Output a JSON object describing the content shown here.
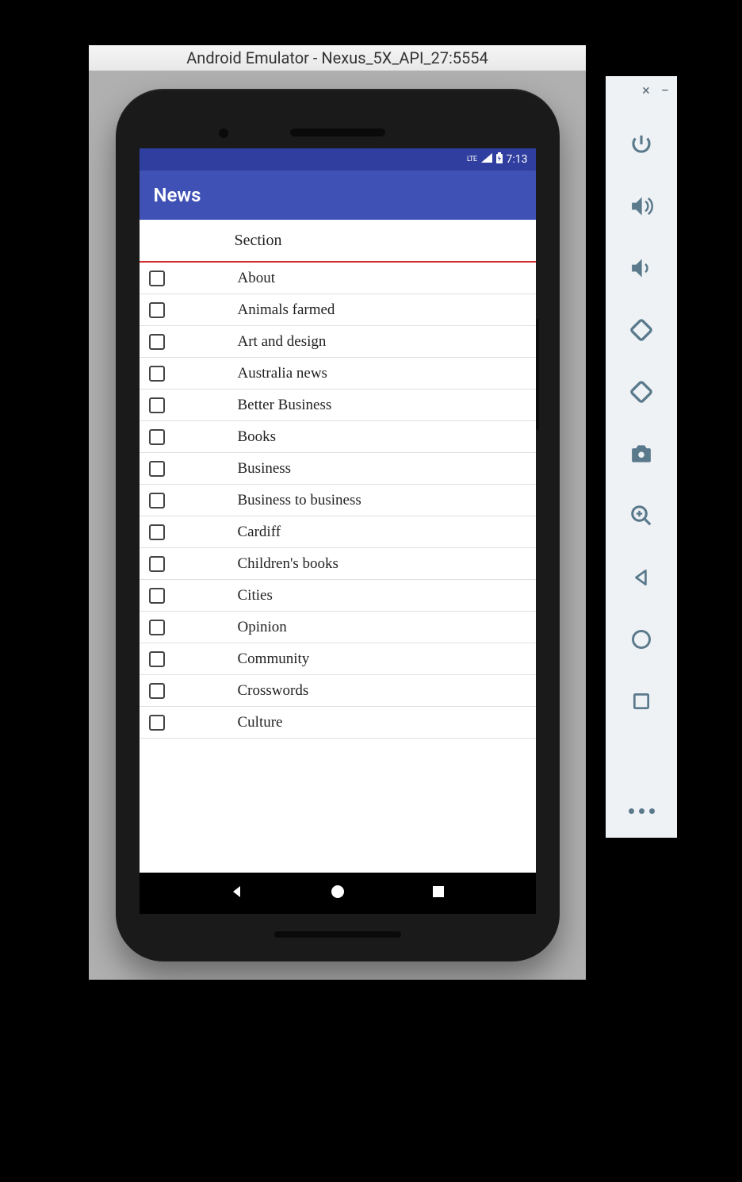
{
  "emulator": {
    "title": "Android Emulator - Nexus_5X_API_27:5554"
  },
  "status": {
    "network": "LTE",
    "time": "7:13"
  },
  "app": {
    "title": "News"
  },
  "section": {
    "header": "Section",
    "items": [
      {
        "label": "About",
        "checked": false
      },
      {
        "label": "Animals farmed",
        "checked": false
      },
      {
        "label": "Art and design",
        "checked": false
      },
      {
        "label": "Australia news",
        "checked": false
      },
      {
        "label": "Better Business",
        "checked": false
      },
      {
        "label": "Books",
        "checked": false
      },
      {
        "label": "Business",
        "checked": false
      },
      {
        "label": "Business to business",
        "checked": false
      },
      {
        "label": "Cardiff",
        "checked": false
      },
      {
        "label": "Children's books",
        "checked": false
      },
      {
        "label": "Cities",
        "checked": false
      },
      {
        "label": "Opinion",
        "checked": false
      },
      {
        "label": "Community",
        "checked": false
      },
      {
        "label": "Crosswords",
        "checked": false
      },
      {
        "label": "Culture",
        "checked": false
      }
    ]
  },
  "side_panel": {
    "close": "×",
    "minimize": "−",
    "icons": [
      "power-icon",
      "volume-up-icon",
      "volume-down-icon",
      "rotate-left-icon",
      "rotate-right-icon",
      "camera-icon",
      "zoom-in-icon",
      "back-icon",
      "home-icon",
      "overview-icon"
    ]
  }
}
